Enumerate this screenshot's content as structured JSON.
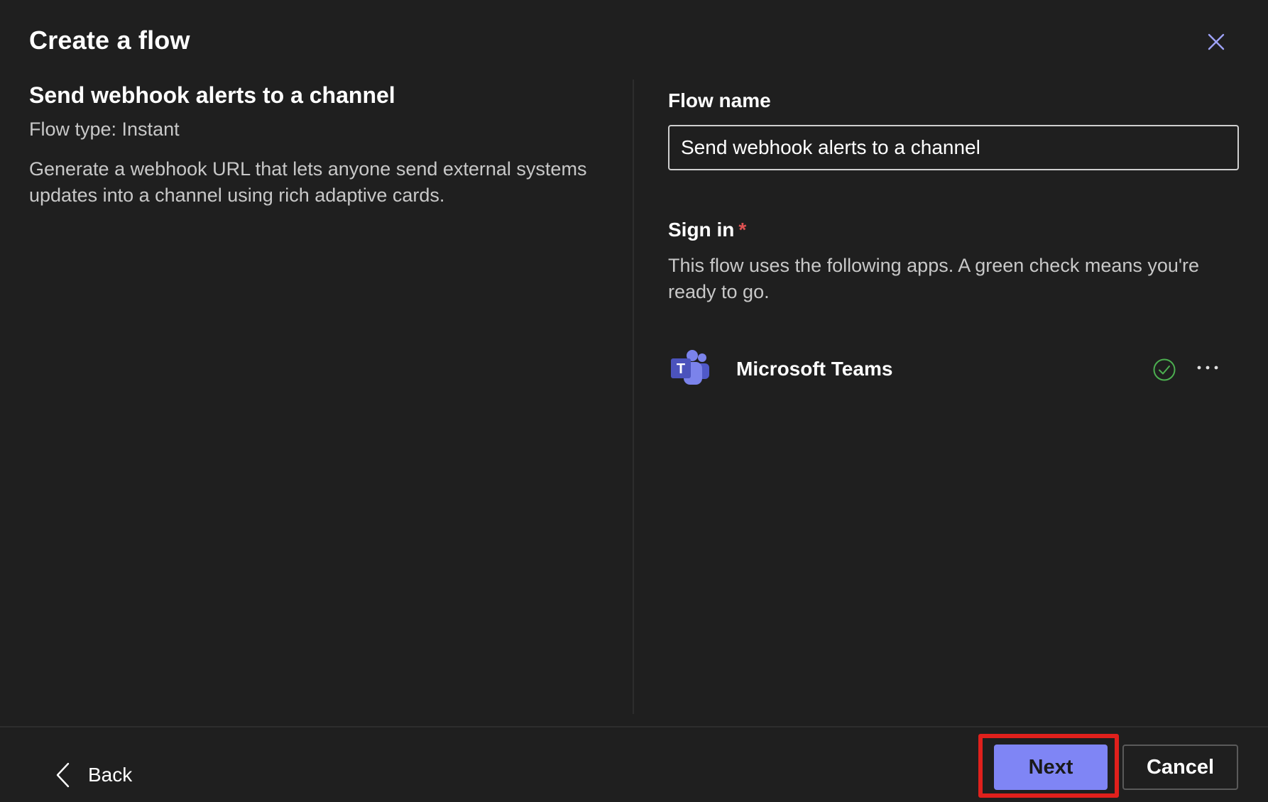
{
  "dialog": {
    "title": "Create a flow",
    "close_icon": "close-icon"
  },
  "template": {
    "title": "Send webhook alerts to a channel",
    "flow_type": "Flow type: Instant",
    "description": "Generate a webhook URL that lets anyone send external systems updates into a channel using rich adaptive cards."
  },
  "form": {
    "flow_name_label": "Flow name",
    "flow_name_value": "Send webhook alerts to a channel",
    "sign_in_label": "Sign in",
    "required_marker": "*",
    "sign_in_description": "This flow uses the following apps. A green check means you're ready to go.",
    "apps": [
      {
        "name": "Microsoft Teams",
        "icon": "microsoft-teams-icon",
        "status": "connected",
        "status_icon": "green-check-icon",
        "more_icon": "more-options-icon"
      }
    ]
  },
  "footer": {
    "back_label": "Back",
    "next_label": "Next",
    "cancel_label": "Cancel"
  },
  "colors": {
    "background": "#1f1f1f",
    "accent": "#7f85f5",
    "highlight": "#e0201c",
    "success": "#4caf50",
    "required": "#e05252"
  }
}
